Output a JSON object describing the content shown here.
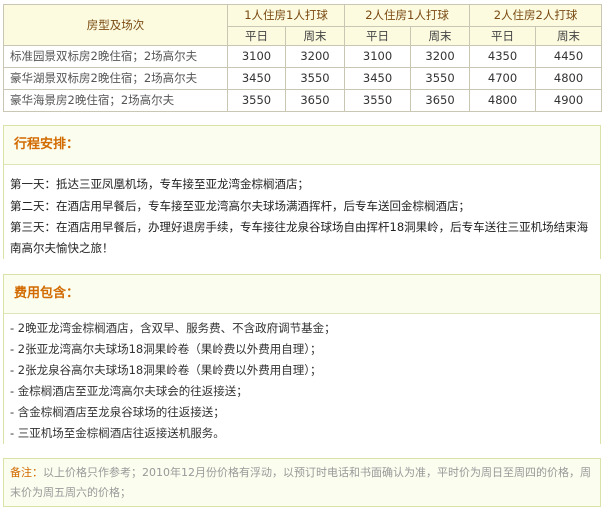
{
  "table": {
    "header": {
      "room_type": "房型及场次",
      "groups": [
        "1人住房1人打球",
        "2人住房1人打球",
        "2人住房2人打球"
      ],
      "sub": [
        "平日",
        "周末",
        "平日",
        "周末",
        "平日",
        "周末"
      ]
    },
    "rows": [
      {
        "name": "标准园景双标房2晚住宿；2场高尔夫",
        "values": [
          "3100",
          "3200",
          "3100",
          "3200",
          "4350",
          "4450"
        ]
      },
      {
        "name": "豪华湖景双标房2晚住宿；2场高尔夫",
        "values": [
          "3450",
          "3550",
          "3450",
          "3550",
          "4700",
          "4800"
        ]
      },
      {
        "name": "豪华海景房2晚住宿；2场高尔夫",
        "values": [
          "3550",
          "3650",
          "3550",
          "3650",
          "4800",
          "4900"
        ]
      }
    ]
  },
  "schedule": {
    "title": "行程安排：",
    "days": [
      "第一天：抵达三亚凤凰机场，专车接至亚龙湾金棕榈酒店；",
      "第二天：在酒店用早餐后，专车接至亚龙湾高尔夫球场满酒挥杆，后专车送回金棕榈酒店；",
      "第三天：在酒店用早餐后，办理好退房手续，专车接往龙泉谷球场自由挥杆18洞果岭，后专车送往三亚机场结束海南高尔夫愉快之旅！"
    ]
  },
  "fees": {
    "title": "费用包含：",
    "items": [
      "- 2晚亚龙湾金棕榈酒店，含双早、服务费、不含政府调节基金；",
      "- 2张亚龙湾高尔夫球场18洞果岭卷（果岭费以外费用自理）；",
      "- 2张龙泉谷高尔夫球场18洞果岭卷（果岭费以外费用自理）；",
      "- 金棕榈酒店至亚龙湾高尔夫球会的往返接送；",
      "- 含金棕榈酒店至龙泉谷球场的往返接送；",
      "- 三亚机场至金棕榈酒店往返接送机服务。"
    ]
  },
  "note": {
    "label": "备注：",
    "text": "以上价格只作参考；2010年12月份价格有浮动，以预订时电话和书面确认为准，平时价为周日至周四的价格，周末价为周五周六的价格；"
  }
}
